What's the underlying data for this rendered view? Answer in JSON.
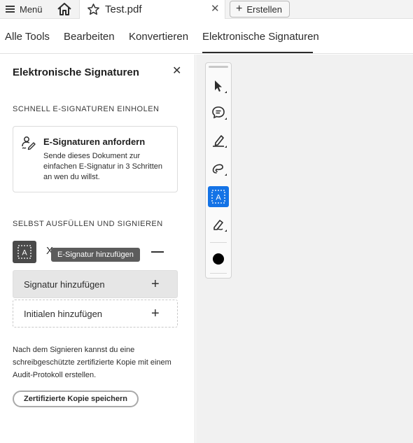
{
  "topbar": {
    "menu_label": "Menü",
    "tab_title": "Test.pdf",
    "tab_close": "✕",
    "create_label": "Erstellen",
    "create_plus": "+"
  },
  "nav": {
    "items": [
      "Alle Tools",
      "Bearbeiten",
      "Konvertieren",
      "Elektronische Signaturen"
    ],
    "active": "Elektronische Signaturen"
  },
  "panel": {
    "title": "Elektronische Signaturen",
    "close": "✕",
    "section1": "SCHNELL E-SIGNATUREN EINHOLEN",
    "card_title": "E-Signaturen anfordern",
    "card_desc": "Sende dieses Dokument zur einfachen E-Signatur in 3 Schritten an wen du willst.",
    "section2": "SELBST AUSFÜLLEN UND SIGNIEREN",
    "x_glyph": "X",
    "tooltip": "E-Signatur hinzufügen",
    "signature_label": "Signatur hinzufügen",
    "initials_label": "Initialen hinzufügen",
    "plus": "+",
    "note": "Nach dem Signieren kannst du eine schreibgeschützte zertifizierte Kopie mit einem Audit-Protokoll erstellen.",
    "copy_button": "Zertifizierte Kopie speichern"
  },
  "toolbar": {
    "tools": [
      "select-arrow-icon",
      "comment-icon",
      "highlight-pen-icon",
      "lasso-draw-icon",
      "text-field-icon",
      "signature-pen-icon",
      "color-dot-icon"
    ],
    "active_tool": "text-field-icon",
    "accent": "#1473e6",
    "current_color": "#000000"
  }
}
